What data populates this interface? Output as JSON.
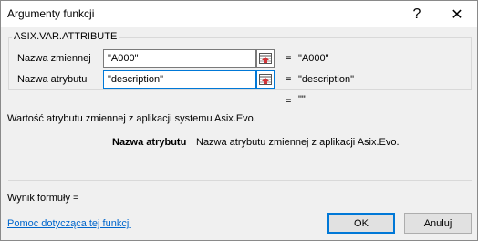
{
  "window": {
    "title": "Argumenty funkcji",
    "help_glyph": "?",
    "close_glyph": "✕"
  },
  "function_group": {
    "name": "ASIX.VAR.ATTRIBUTE",
    "args": [
      {
        "label": "Nazwa zmiennej",
        "value": "\"A000\"",
        "result_eq": "=",
        "result": "\"A000\""
      },
      {
        "label": "Nazwa atrybutu",
        "value": "\"description\"",
        "result_eq": "=",
        "result": "\"description\""
      }
    ],
    "function_result_eq": "=",
    "function_result": "\"\""
  },
  "description": {
    "function_text": "Wartość atrybutu zmiennej z aplikacji systemu Asix.Evo.",
    "arg_name": "Nazwa atrybutu",
    "arg_text": "Nazwa atrybutu zmiennej z aplikacji Asix.Evo."
  },
  "footer": {
    "formula_result_label": "Wynik formuły =",
    "help_link": "Pomoc dotycząca tej funkcji",
    "ok_label": "OK",
    "cancel_label": "Anuluj"
  },
  "icons": {
    "collapse": "collapse-dialog-icon",
    "help": "help-icon",
    "close": "close-icon"
  },
  "colors": {
    "focus_border": "#0078d7",
    "link": "#0066cc"
  }
}
